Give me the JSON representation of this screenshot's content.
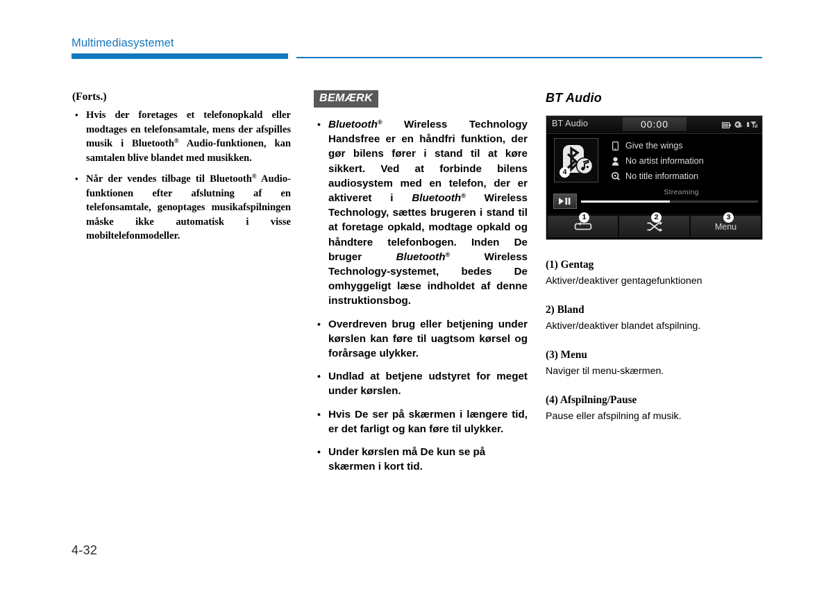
{
  "header": {
    "title": "Multimediasystemet",
    "accent_color": "#1279bf"
  },
  "left_column": {
    "continued_label": "(Forts.)",
    "bullets": [
      {
        "pre": "Hvis der foretages et telefonopkald eller modtages en telefonsamtale, mens der afspilles musik i Bluetooth",
        "reg": "®",
        "post": " Audio-funktionen, kan samtalen blive blandet med musikken."
      },
      {
        "pre": "Når der vendes tilbage til Bluetooth",
        "reg": "®",
        "post": " Audio-funktionen efter afslutning af en telefonsamtale, genoptages musikafspilningen måske ikke automatisk i visse mobiltelefonmodeller."
      }
    ]
  },
  "middle_column": {
    "note_badge": "BEMÆRK",
    "bullets": [
      {
        "segments": [
          {
            "text": "Bluetooth",
            "italic": true
          },
          {
            "text": "®",
            "italic": true,
            "sup": true
          },
          {
            "text": " Wireless Technology Handsfree er en håndfri funktion, der gør bilens fører i stand til at køre sikkert. Ved at forbinde bilens audiosystem med en telefon, der er aktiveret i ",
            "italic": false
          },
          {
            "text": "Bluetooth",
            "italic": true
          },
          {
            "text": "®",
            "italic": true,
            "sup": true
          },
          {
            "text": " Wireless Technology, sættes brugeren i stand til at foretage opkald, modtage opkald og håndtere telefonbogen. Inden De bruger ",
            "italic": false
          },
          {
            "text": "Bluetooth",
            "italic": true
          },
          {
            "text": "®",
            "italic": true,
            "sup": true
          },
          {
            "text": " Wireless Technology-systemet, bedes De omhyggeligt læse indholdet af denne instruktionsbog.",
            "italic": false
          }
        ]
      },
      {
        "segments": [
          {
            "text": "Overdreven brug eller betjening under kørslen kan føre til uagtsom kørsel og forårsage ulykker.",
            "italic": false
          }
        ]
      },
      {
        "segments": [
          {
            "text": "Undlad at betjene udstyret for meget under kørslen.",
            "italic": false
          }
        ]
      },
      {
        "segments": [
          {
            "text": "Hvis De ser på skærmen i længere tid, er det farligt og kan føre til ulykker.",
            "italic": false
          }
        ]
      },
      {
        "segments": [
          {
            "text": "Under kørslen må De kun se på skærmen i kort tid.",
            "italic": false
          }
        ]
      }
    ]
  },
  "right_column": {
    "heading": "BT Audio",
    "screen": {
      "status_title": "BT Audio",
      "clock": "00:00",
      "status_icons": [
        "battery-icon",
        "mute-sound-icon",
        "signal-antenna-icon"
      ],
      "album_art_icon": "bluetooth-music-icon",
      "track_lines": [
        {
          "icon": "device-phone-icon",
          "text": "Give the wings"
        },
        {
          "icon": "artist-person-icon",
          "text": "No artist information"
        },
        {
          "icon": "title-disc-icon",
          "text": "No title information"
        }
      ],
      "status_text": "Streaming",
      "progress_percent": 50,
      "play_pause_icon": "play-pause-icon",
      "softkeys": [
        {
          "icon": "repeat-icon",
          "label": ""
        },
        {
          "icon": "shuffle-icon",
          "label": ""
        },
        {
          "icon": "",
          "label": "Menu"
        }
      ],
      "callouts": [
        "1",
        "2",
        "3",
        "4"
      ]
    },
    "descriptions": [
      {
        "title": "(1) Gentag",
        "body": "Aktiver/deaktiver gentagefunktionen"
      },
      {
        "title": "2) Bland",
        "body": "Aktiver/deaktiver blandet afspilning."
      },
      {
        "title": "(3) Menu",
        "body": "Naviger til menu-skærmen."
      },
      {
        "title": "(4) Afspilning/Pause",
        "body": "Pause eller afspilning af musik."
      }
    ]
  },
  "footer": {
    "page_number": "4-32"
  }
}
